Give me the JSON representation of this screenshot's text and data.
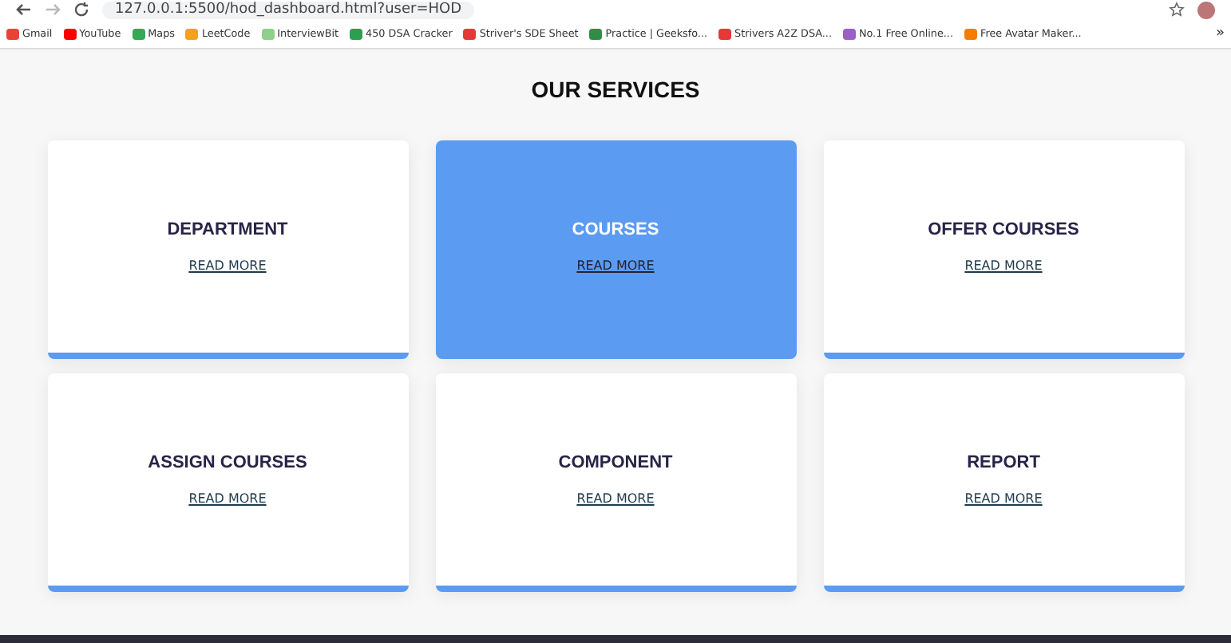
{
  "browser": {
    "address": "127.0.0.1:5500/hod_dashboard.html?user=HOD",
    "bookmarks": [
      {
        "label": "Gmail",
        "color": "#ea4335"
      },
      {
        "label": "YouTube",
        "color": "#ff0000"
      },
      {
        "label": "Maps",
        "color": "#34a853"
      },
      {
        "label": "LeetCode",
        "color": "#f89f1b"
      },
      {
        "label": "InterviewBit",
        "color": "#8fcf8a"
      },
      {
        "label": "450 DSA Cracker",
        "color": "#2e9e4f"
      },
      {
        "label": "Striver's SDE Sheet",
        "color": "#e53935"
      },
      {
        "label": "Practice | Geeksfo...",
        "color": "#2f8d46"
      },
      {
        "label": "Strivers A2Z DSA...",
        "color": "#e53935"
      },
      {
        "label": "No.1 Free Online...",
        "color": "#9c5fc9"
      },
      {
        "label": "Free Avatar Maker...",
        "color": "#f57c00"
      }
    ],
    "more": "»"
  },
  "heading": "OUR SERVICES",
  "cards": [
    {
      "title": "DEPARTMENT",
      "link": "READ MORE",
      "selected": false
    },
    {
      "title": "COURSES",
      "link": "READ MORE",
      "selected": true
    },
    {
      "title": "OFFER COURSES",
      "link": "READ MORE",
      "selected": false
    },
    {
      "title": "ASSIGN COURSES",
      "link": "READ MORE",
      "selected": false
    },
    {
      "title": "COMPONENT",
      "link": "READ MORE",
      "selected": false
    },
    {
      "title": "REPORT",
      "link": "READ MORE",
      "selected": false
    }
  ]
}
